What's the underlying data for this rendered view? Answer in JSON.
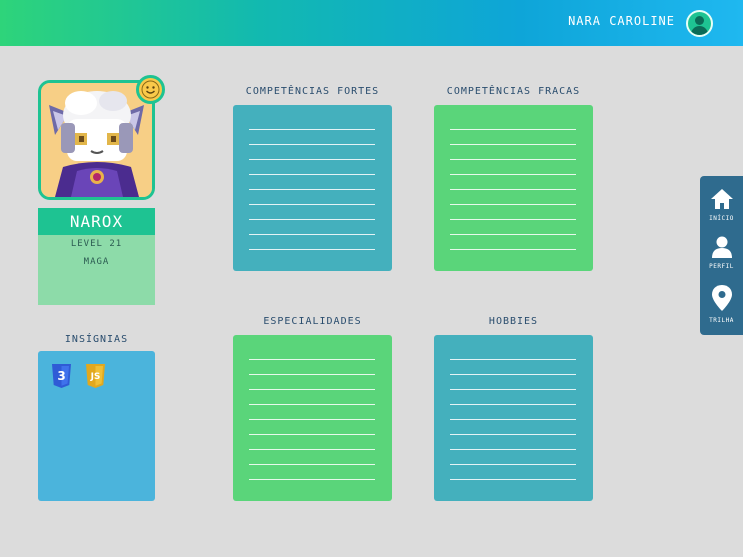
{
  "header": {
    "user_name": "NARA CAROLINE",
    "avatar_icon": "user-avatar-icon"
  },
  "character": {
    "name": "NAROX",
    "level": "LEVEL 21",
    "class": "MAGA",
    "mood_icon": "smiley-face-icon"
  },
  "badges": {
    "title": "INSÍGNIAS",
    "items": [
      {
        "name": "css3-badge-icon",
        "text": "3"
      },
      {
        "name": "js-badge-icon",
        "text": "JS"
      }
    ]
  },
  "cards": {
    "strong": {
      "title": "COMPETÊNCIAS FORTES"
    },
    "weak": {
      "title": "COMPETÊNCIAS FRACAS"
    },
    "special": {
      "title": "ESPECIALIDADES"
    },
    "hobbies": {
      "title": "HOBBIES"
    }
  },
  "sidenav": {
    "home": "INÍCIO",
    "profile": "PERFIL",
    "trail": "TRILHA"
  },
  "colors": {
    "accent": "#1ec392",
    "teal_card": "#44b0bd",
    "green_card": "#5ad57a",
    "sidebar": "#2f6b8e",
    "badge_box": "#4bb4dc"
  }
}
